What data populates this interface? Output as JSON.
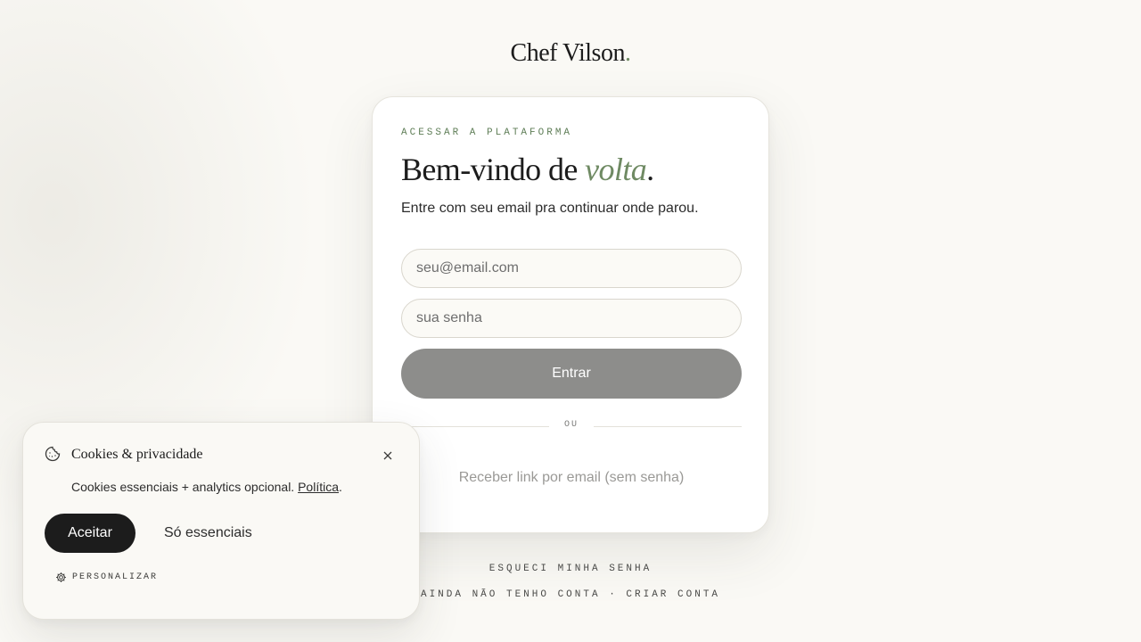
{
  "brand": {
    "name": "Chef Vilson",
    "dot": "."
  },
  "login": {
    "eyebrow": "ACESSAR A PLATAFORMA",
    "title_prefix": "Bem-vindo de ",
    "title_emphasis": "volta",
    "title_suffix": ".",
    "subtitle": "Entre com seu email pra continuar onde parou.",
    "email": {
      "value": "",
      "placeholder": "seu@email.com"
    },
    "password": {
      "value": "",
      "placeholder": "sua senha"
    },
    "submit_label": "Entrar",
    "divider_label": "OU",
    "magic_link_label": "Receber link por email (sem senha)"
  },
  "footer": {
    "forgot_password": "ESQUECI MINHA SENHA",
    "no_account_prefix": "AINDA NÃO TENHO CONTA",
    "separator": " · ",
    "create_account": "CRIAR CONTA"
  },
  "cookie_banner": {
    "icon": "cookie-icon",
    "title": "Cookies & privacidade",
    "text": "Cookies essenciais + analytics opcional. ",
    "policy_link": "Política",
    "text_end": ".",
    "accept_label": "Aceitar",
    "essentials_label": "Só essenciais",
    "customize_label": "PERSONALIZAR",
    "customize_icon": "gear-icon",
    "close_icon": "close-icon"
  },
  "colors": {
    "accent_green": "#6f8a63",
    "button_disabled": "#8d8d8b",
    "button_dark": "#1c1c1c",
    "background": "#faf9f5"
  }
}
